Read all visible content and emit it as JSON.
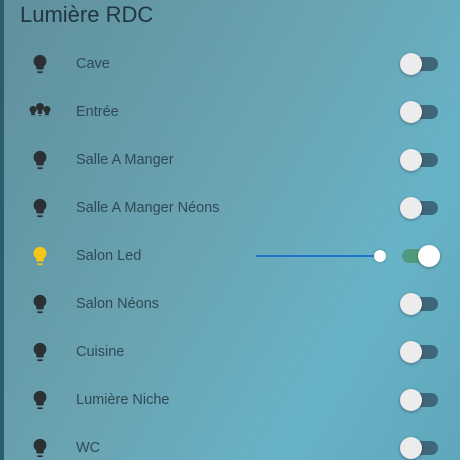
{
  "card": {
    "title": "Lumière RDC"
  },
  "colors": {
    "icon_off": "#2b3033",
    "icon_on": "#f5c518",
    "toggle_on": "#4f9a7e",
    "toggle_off": "#40667a",
    "slider": "#1d74c8"
  },
  "lights": [
    {
      "label": "Cave",
      "icon": "bulb-icon",
      "state": "off"
    },
    {
      "label": "Entrée",
      "icon": "chandelier-icon",
      "state": "off"
    },
    {
      "label": "Salle A Manger",
      "icon": "bulb-icon",
      "state": "off"
    },
    {
      "label": "Salle A Manger Néons",
      "icon": "bulb-icon",
      "state": "off"
    },
    {
      "label": "Salon Led",
      "icon": "bulb-icon",
      "state": "on",
      "brightness": 1.0
    },
    {
      "label": "Salon Néons",
      "icon": "bulb-icon",
      "state": "off"
    },
    {
      "label": "Cuisine",
      "icon": "bulb-icon",
      "state": "off"
    },
    {
      "label": "Lumière Niche",
      "icon": "bulb-icon",
      "state": "off"
    },
    {
      "label": "WC",
      "icon": "bulb-icon",
      "state": "off"
    }
  ]
}
